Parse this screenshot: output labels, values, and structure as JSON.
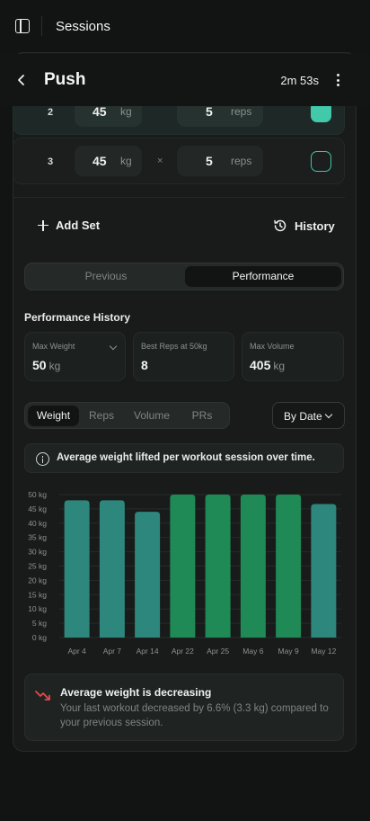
{
  "app": {
    "title": "Sessions"
  },
  "workout": {
    "title": "Push",
    "timer": "2m 53s"
  },
  "sets": [
    {
      "number": "2",
      "weight": "45",
      "weight_unit": "kg",
      "reps": "5",
      "reps_unit": "reps",
      "completed": true
    },
    {
      "number": "3",
      "weight": "45",
      "weight_unit": "kg",
      "times": "×",
      "reps": "5",
      "reps_unit": "reps",
      "completed": false
    }
  ],
  "actions": {
    "add_set": "Add Set",
    "history": "History"
  },
  "view_toggle": {
    "options": [
      "Previous",
      "Performance"
    ],
    "selected": "Performance"
  },
  "performance": {
    "title": "Performance History",
    "stats": [
      {
        "label": "Max Weight",
        "value": "50",
        "unit": "kg"
      },
      {
        "label": "Best Reps at 50kg",
        "value": "8",
        "unit": ""
      },
      {
        "label": "Max Volume",
        "value": "405",
        "unit": "kg"
      }
    ],
    "metric_tabs": [
      "Weight",
      "Reps",
      "Volume",
      "PRs"
    ],
    "selected_metric": "Weight",
    "sort": "By Date",
    "info": "Average weight lifted per workout session over time.",
    "trend": {
      "title": "Average weight is decreasing",
      "body": "Your last workout decreased by 6.6% (3.3 kg) compared to your previous session."
    }
  },
  "colors": {
    "accent": "#41c9aa",
    "bar_teal": "#2e877c",
    "bar_green": "#1f8a56",
    "trend_down": "#e5484d"
  },
  "chart_data": {
    "type": "bar",
    "categories": [
      "Apr 4",
      "Apr 7",
      "Apr 14",
      "Apr 22",
      "Apr 25",
      "May 6",
      "May 9",
      "May 12"
    ],
    "values": [
      48,
      48,
      44,
      50,
      50,
      50,
      50,
      46.7
    ],
    "ylim": [
      0,
      50
    ],
    "y_ticks": [
      "0 kg",
      "5 kg",
      "10 kg",
      "15 kg",
      "20 kg",
      "25 kg",
      "30 kg",
      "35 kg",
      "40 kg",
      "45 kg",
      "50 kg"
    ],
    "highlighted": [
      false,
      false,
      false,
      true,
      true,
      true,
      true,
      false
    ],
    "grid": true
  }
}
